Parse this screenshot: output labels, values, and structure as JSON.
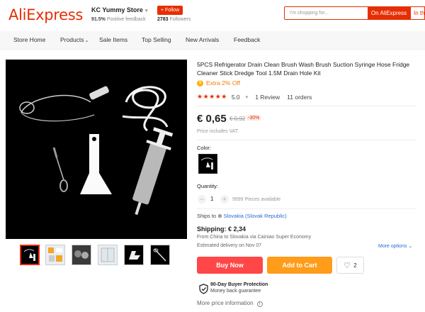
{
  "header": {
    "logo": "AliExpress",
    "store_name": "KC Yummy Store",
    "feedback_pct": "91.5%",
    "feedback_label": "Positive feedback",
    "follow_label": "+ Follow",
    "followers_count": "2783",
    "followers_label": "Followers",
    "search_placeholder": "I'm shopping for...",
    "search_btn": "On AliExpress",
    "search_btn2": "In th"
  },
  "nav": {
    "items": [
      "Store Home",
      "Products",
      "Sale Items",
      "Top Selling",
      "New Arrivals",
      "Feedback"
    ]
  },
  "product": {
    "title": "5PCS Refrigerator Drain Clean Brush Wash Brush Suction Syringe Hose Fridge Cleaner Stick Dredge Tool 1.5M Drain Hole Kit",
    "extra_off": "Extra 2% Off",
    "stars": "★★★★★",
    "rating": "5.0",
    "reviews": "1 Review",
    "orders": "11 orders",
    "price": "€ 0,65",
    "old_price": "€ 0,92",
    "discount": "-30%",
    "vat_note": "Price includes VAT",
    "color_label": "Color:",
    "quantity_label": "Quantity:",
    "quantity": "1",
    "available": "9999 Pieces available",
    "ships_to_label": "Ships to",
    "ships_to_country": "Slovakia (Slovak Republic)",
    "shipping": "Shipping: € 2,34",
    "from_text": "From China to Slovakia via Cainiao Super Economy",
    "delivery": "Estimated delivery on Nov 07",
    "more_options": "More options",
    "buy_now": "Buy Now",
    "add_to_cart": "Add to Cart",
    "wishlist_count": "2",
    "protection_title": "90-Day Buyer Protection",
    "protection_sub": "Money back guarantee",
    "more_price_info": "More price information"
  },
  "colors": {
    "brand": "#e62e04",
    "buy": "#ff4747",
    "cart": "#ff9c19",
    "link": "#2a6ad3"
  }
}
